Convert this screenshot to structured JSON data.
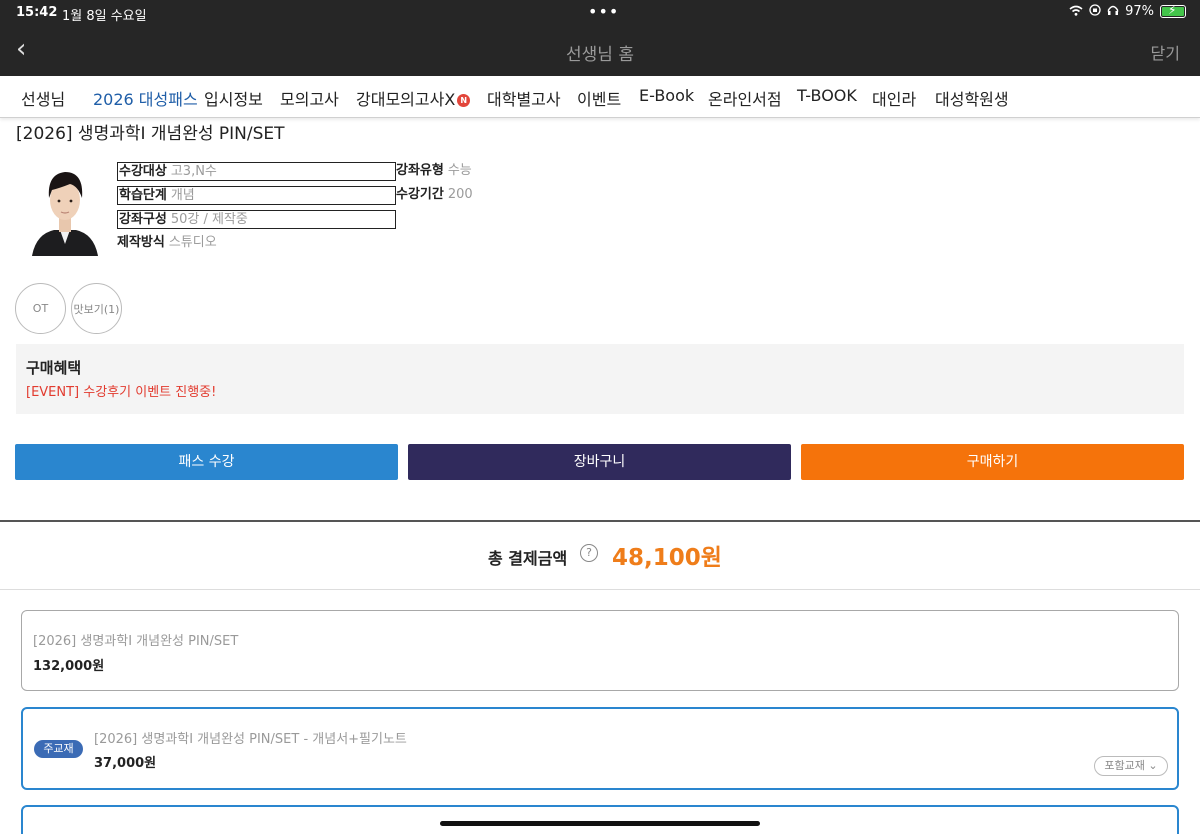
{
  "status": {
    "time": "15:42",
    "date": "1월 8일 수요일",
    "battery": "97%",
    "battery_level": 0.97
  },
  "header": {
    "back_icon": "chevron-left-icon",
    "title": "선생님 홈",
    "close_label": "닫기"
  },
  "nav": {
    "items": [
      {
        "label": "선생님"
      },
      {
        "label": "2026 대성패스"
      },
      {
        "label": "입시정보"
      },
      {
        "label": "모의고사"
      },
      {
        "label": "강대모의고사X",
        "badge": "N"
      },
      {
        "label": "대학별고사"
      },
      {
        "label": "이벤트"
      },
      {
        "label": "E-Book"
      },
      {
        "label": "온라인서점"
      },
      {
        "label": "T-BOOK"
      },
      {
        "label": "대인라"
      },
      {
        "label": "대성학원생"
      }
    ],
    "active_index": 1,
    "active_color": "#1f5ea8"
  },
  "course": {
    "title": "[2026] 생명과학I 개념완성 PIN/SET",
    "info": {
      "target_label": "수강대상",
      "target_value": "고3,N수",
      "type_label": "강좌유형",
      "type_value": "수능",
      "stage_label": "학습단계",
      "stage_value": "개념",
      "period_label": "수강기간",
      "period_value": "200",
      "composition_label": "강좌구성",
      "composition_value": "50강 / 제작중",
      "production_label": "제작방식",
      "production_value": "스튜디오"
    },
    "previews": [
      "OT",
      "맛보기(1)"
    ]
  },
  "benefit": {
    "heading": "구매혜택",
    "event": "[EVENT] 수강후기 이벤트 진행중!"
  },
  "actions": {
    "pass_label": "패스 수강",
    "cart_label": "장바구니",
    "buy_label": "구매하기",
    "colors": {
      "pass": "#2a86cf",
      "cart": "#302a5c",
      "buy": "#f5730b"
    }
  },
  "total": {
    "label": "총 결제금액",
    "help_icon": "?",
    "amount": "48,100원",
    "amount_color": "#ef7d1a"
  },
  "items": [
    {
      "title": "[2026] 생명과학I 개념완성 PIN/SET",
      "price": "132,000원"
    },
    {
      "tag": "주교재",
      "title": "[2026] 생명과학I 개념완성 PIN/SET - 개념서+필기노트",
      "price": "37,000원",
      "dropdown": "포함교재"
    }
  ]
}
